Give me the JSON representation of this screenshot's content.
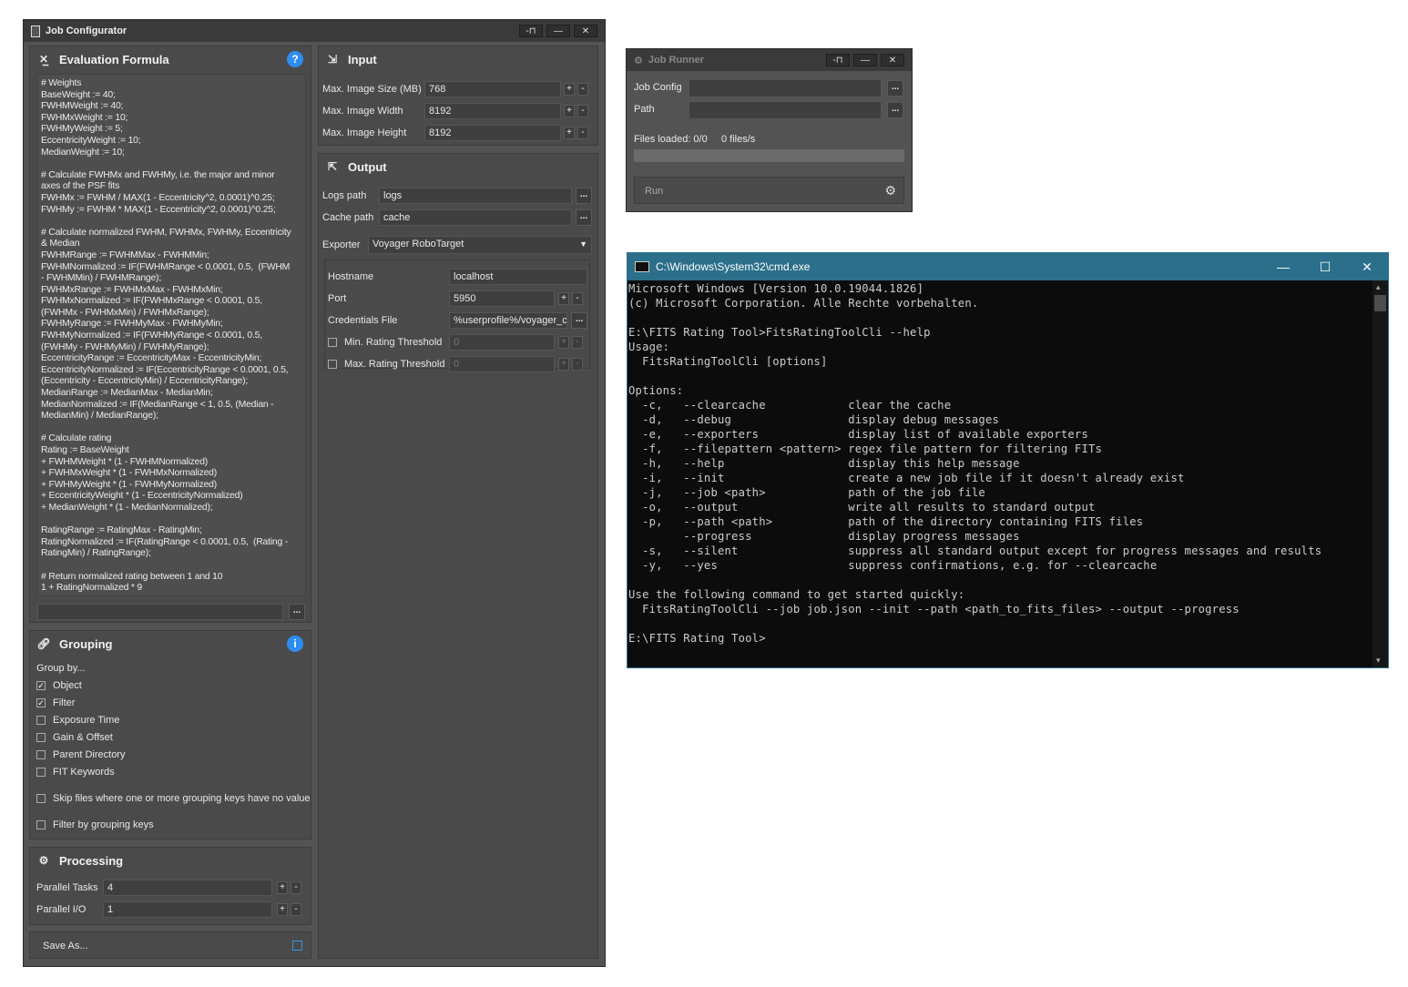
{
  "job_configurator": {
    "title": "Job Configurator",
    "title_buttons": [
      "-⊓",
      "—",
      "✕"
    ],
    "evaluation": {
      "title": "Evaluation Formula",
      "help": "?",
      "formula": "# Weights\nBaseWeight := 40;\nFWHMWeight := 40;\nFWHMxWeight := 10;\nFWHMyWeight := 5;\nEccentricityWeight := 10;\nMedianWeight := 10;\n\n# Calculate FWHMx and FWHMy, i.e. the major and minor\naxes of the PSF fits\nFWHMx := FWHM / MAX(1 - Eccentricity^2, 0.0001)^0.25;\nFWHMy := FWHM * MAX(1 - Eccentricity^2, 0.0001)^0.25;\n\n# Calculate normalized FWHM, FWHMx, FWHMy, Eccentricity\n& Median\nFWHMRange := FWHMMax - FWHMMin;\nFWHMNormalized := IF(FWHMRange < 0.0001, 0.5,  (FWHM\n- FWHMMin) / FWHMRange);\nFWHMxRange := FWHMxMax - FWHMxMin;\nFWHMxNormalized := IF(FWHMxRange < 0.0001, 0.5,\n(FWHMx - FWHMxMin) / FWHMxRange);\nFWHMyRange := FWHMyMax - FWHMyMin;\nFWHMyNormalized := IF(FWHMyRange < 0.0001, 0.5,\n(FWHMy - FWHMyMin) / FWHMyRange);\nEccentricityRange := EccentricityMax - EccentricityMin;\nEccentricityNormalized := IF(EccentricityRange < 0.0001, 0.5,\n(Eccentricity - EccentricityMin) / EccentricityRange);\nMedianRange := MedianMax - MedianMin;\nMedianNormalized := IF(MedianRange < 1, 0.5, (Median -\nMedianMin) / MedianRange);\n\n# Calculate rating\nRating := BaseWeight\n+ FWHMWeight * (1 - FWHMNormalized)\n+ FWHMxWeight * (1 - FWHMxNormalized)\n+ FWHMyWeight * (1 - FWHMyNormalized)\n+ EccentricityWeight * (1 - EccentricityNormalized)\n+ MedianWeight * (1 - MedianNormalized);\n\nRatingRange := RatingMax - RatingMin;\nRatingNormalized := IF(RatingRange < 0.0001, 0.5,  (Rating -\nRatingMin) / RatingRange);\n\n# Return normalized rating between 1 and 10\n1 + RatingNormalized * 9",
      "browse": "..."
    },
    "grouping": {
      "title": "Grouping",
      "info": "i",
      "group_by_label": "Group by...",
      "options": [
        {
          "label": "Object",
          "checked": true
        },
        {
          "label": "Filter",
          "checked": true
        },
        {
          "label": "Exposure Time",
          "checked": false
        },
        {
          "label": "Gain & Offset",
          "checked": false
        },
        {
          "label": "Parent Directory",
          "checked": false
        },
        {
          "label": "FIT Keywords",
          "checked": false
        }
      ],
      "skip_label": "Skip files where one or more grouping keys have no value",
      "filter_label": "Filter by grouping keys"
    },
    "processing": {
      "title": "Processing",
      "parallel_tasks_label": "Parallel Tasks",
      "parallel_tasks": "4",
      "parallel_io_label": "Parallel I/O",
      "parallel_io": "1"
    },
    "save_as": "Save As...",
    "input": {
      "title": "Input",
      "max_size_label": "Max. Image Size (MB)",
      "max_size": "768",
      "max_width_label": "Max. Image Width",
      "max_width": "8192",
      "max_height_label": "Max. Image Height",
      "max_height": "8192"
    },
    "output": {
      "title": "Output",
      "logs_label": "Logs path",
      "logs": "logs",
      "cache_label": "Cache path",
      "cache": "cache",
      "exporter_label": "Exporter",
      "exporter": "Voyager RoboTarget",
      "hostname_label": "Hostname",
      "hostname": "localhost",
      "port_label": "Port",
      "port": "5950",
      "credentials_label": "Credentials File",
      "credentials": "%userprofile%/voyager_c",
      "min_rating_label": "Min. Rating Threshold",
      "min_rating": "0",
      "max_rating_label": "Max. Rating Threshold",
      "max_rating": "0"
    },
    "plus": "+",
    "minus": "-"
  },
  "job_runner": {
    "title": "Job Runner",
    "job_config_label": "Job Config",
    "job_config": "",
    "path_label": "Path",
    "path": "",
    "status": "Files loaded: 0/0     0 files/s",
    "progress": 0,
    "run": "Run"
  },
  "cmd": {
    "title": "C:\\Windows\\System32\\cmd.exe",
    "output": "Microsoft Windows [Version 10.0.19044.1826]\n(c) Microsoft Corporation. Alle Rechte vorbehalten.\n\nE:\\FITS Rating Tool>FitsRatingToolCli --help\nUsage:\n  FitsRatingToolCli [options]\n\nOptions:\n  -c,   --clearcache            clear the cache\n  -d,   --debug                 display debug messages\n  -e,   --exporters             display list of available exporters\n  -f,   --filepattern <pattern> regex file pattern for filtering FITs\n  -h,   --help                  display this help message\n  -i,   --init                  create a new job file if it doesn't already exist\n  -j,   --job <path>            path of the job file\n  -o,   --output                write all results to standard output\n  -p,   --path <path>           path of the directory containing FITS files\n        --progress              display progress messages\n  -s,   --silent                suppress all standard output except for progress messages and results\n  -y,   --yes                   suppress confirmations, e.g. for --clearcache\n\nUse the following command to get started quickly:\n  FitsRatingToolCli --job job.json --init --path <path_to_fits_files> --output --progress\n\nE:\\FITS Rating Tool>"
  }
}
